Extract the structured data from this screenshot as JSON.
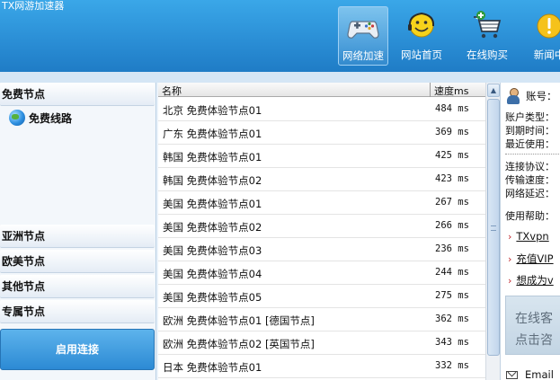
{
  "app": {
    "title": "TX网游加速器"
  },
  "nav": [
    {
      "label": "网络加速",
      "icon": "gamepad-icon",
      "active": true
    },
    {
      "label": "网站首页",
      "icon": "smiley-icon",
      "active": false
    },
    {
      "label": "在线购买",
      "icon": "shopping-cart-icon",
      "active": false
    },
    {
      "label": "新闻中",
      "icon": "news-icon",
      "active": false
    }
  ],
  "sidebar": {
    "groups": [
      "免费节点",
      "亚洲节点",
      "欧美节点",
      "其他节点",
      "专属节点"
    ],
    "free_line": {
      "label": "免费线路",
      "icon": "globe-icon"
    },
    "connect_label": "启用连接"
  },
  "table": {
    "headers": {
      "name": "名称",
      "speed": "速度ms"
    },
    "rows": [
      {
        "name": "北京 免费体验节点01",
        "speed": "484 ms"
      },
      {
        "name": "广东 免费体验节点01",
        "speed": "369 ms"
      },
      {
        "name": "韩国 免费体验节点01",
        "speed": "425 ms"
      },
      {
        "name": "韩国 免费体验节点02",
        "speed": "423 ms"
      },
      {
        "name": "美国 免费体验节点01",
        "speed": "267 ms"
      },
      {
        "name": "美国 免费体验节点02",
        "speed": "266 ms"
      },
      {
        "name": "美国 免费体验节点03",
        "speed": "236 ms"
      },
      {
        "name": "美国 免费体验节点04",
        "speed": "244 ms"
      },
      {
        "name": "美国 免费体验节点05",
        "speed": "275 ms"
      },
      {
        "name": "欧洲 免费体验节点01 [德国节点]",
        "speed": "362 ms"
      },
      {
        "name": "欧洲 免费体验节点02 [英国节点]",
        "speed": "343 ms"
      },
      {
        "name": "日本 免费体验节点01",
        "speed": "332 ms"
      }
    ],
    "scroll_up_symbol": "▲"
  },
  "account": {
    "account_label": "账号：",
    "type_label": "账户类型：",
    "expiry_label": "到期时间：",
    "last_used_label": "最近使用：",
    "protocol_label": "连接协议：",
    "transfer_label": "传输速度：",
    "latency_label": "网络延迟：",
    "help_label": "使用帮助：",
    "help_links": [
      "TXvpn",
      "充值VIP",
      "想成为v"
    ],
    "banner_line1": "在线客",
    "banner_line2": "点击咨",
    "email_label": "Email"
  },
  "colors": {
    "header": "#2b8fd6",
    "accent": "#2c8ad4",
    "link_arrow": "#c0272d"
  }
}
